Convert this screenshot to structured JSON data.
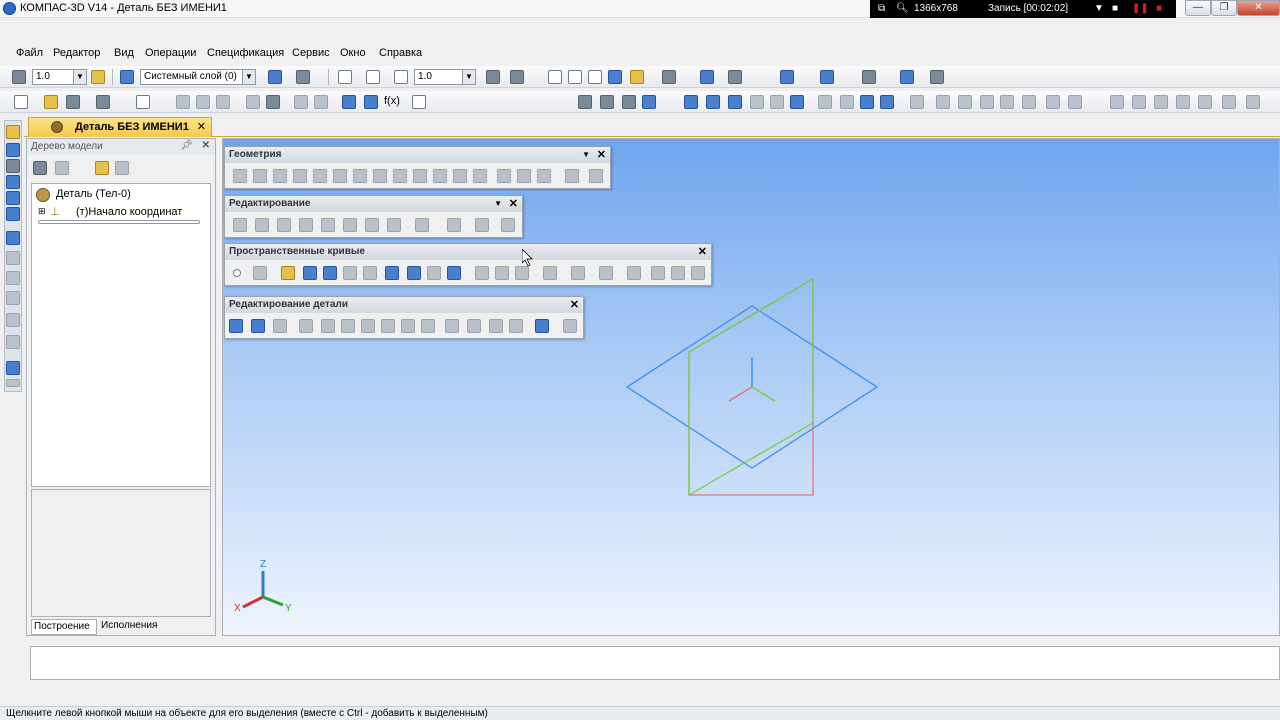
{
  "window": {
    "title": "КОМПАС-3D V14 - Деталь БЕЗ ИМЕНИ1"
  },
  "recorder": {
    "resolution": "1366x768",
    "record_label": "Запись [00:02:02]"
  },
  "menu": {
    "items": [
      "Файл",
      "Редактор",
      "Вид",
      "Операции",
      "Спецификация",
      "Сервис",
      "Окно",
      "Справка"
    ]
  },
  "toolbar": {
    "step_value": "1.0",
    "layer_value": "Системный слой (0)",
    "zoom_value": "1.0",
    "fx_label": "f(x)"
  },
  "document": {
    "tab_label": "Деталь БЕЗ ИМЕНИ1"
  },
  "tree": {
    "header": "Дерево модели",
    "root_label": "Деталь (Тел-0)",
    "child_label": "(т)Начало координат",
    "tabs": [
      "Построение",
      "Исполнения"
    ]
  },
  "panels": {
    "geometry": "Геометрия",
    "editing": "Редактирование",
    "space_curves": "Пространственные кривые",
    "part_editing": "Редактирование детали"
  },
  "axes": {
    "x": "X",
    "y": "Y",
    "z": "Z"
  },
  "status": {
    "text": "Щелкните левой кнопкой мыши на объекте для его выделения (вместе с Ctrl - добавить к выделенным)"
  },
  "colors": {
    "plane_xy": "#3d8fe8",
    "plane_zx": "#e07878",
    "plane_zy": "#74d04a",
    "tab_active": "#f5c94a"
  }
}
